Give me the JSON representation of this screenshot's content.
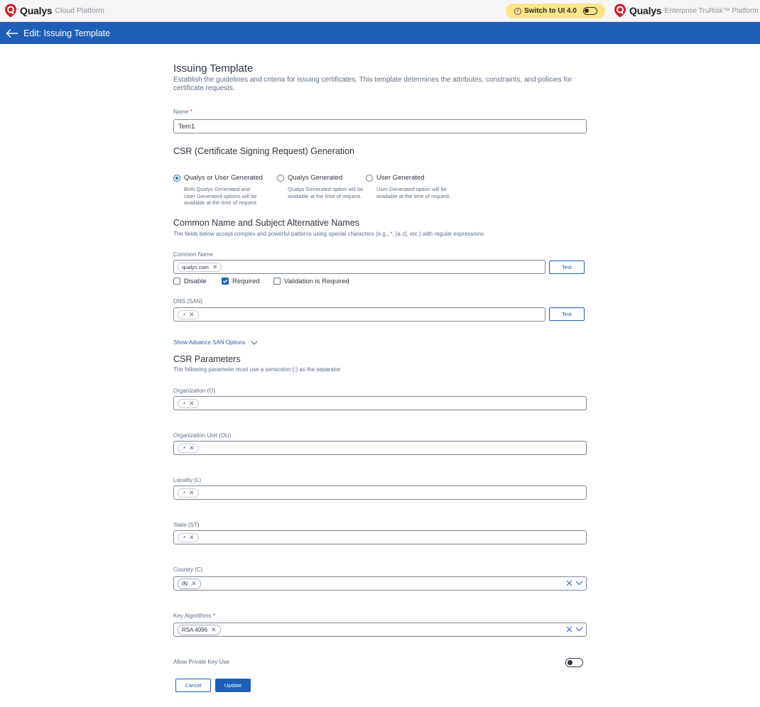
{
  "topbar": {
    "brand_name": "Qualys",
    "brand_sub": "Cloud Platform",
    "switch_label": "Switch to UI 4.0",
    "right_brand_name": "Qualys",
    "right_brand_sub": "Enterprise TruRisk™ Platform",
    "brand_color": "#d0202e"
  },
  "header": {
    "title": "Edit: Issuing Template",
    "color": "#1d5fb6"
  },
  "form": {
    "title": "Issuing Template",
    "description": "Establish the guidelines and criteria for issuing certificates. This template determines the attributes, constraints, and policies for certificate requests.",
    "name": {
      "label": "Name",
      "required_mark": "*",
      "value": "Tem1"
    },
    "csr_generation": {
      "title": "CSR (Certificate Signing Request) Generation",
      "options": [
        {
          "label": "Qualys or User Generated",
          "description": "Both Qualys Generated and User Generated options will be available at the time of request",
          "selected": true
        },
        {
          "label": "Qualys Generated",
          "description": "Qualys Generated option will be available at the time of request.",
          "selected": false
        },
        {
          "label": "User Generated",
          "description": "User Generated option will be available at the time of request.",
          "selected": false
        }
      ]
    },
    "cn_san": {
      "title": "Common Name and Subject Alternative Names",
      "description": "The fields below accept complex and powerful patterns using special characters (e.g., *, [a-z], etc.) with regular expressions",
      "common_name": {
        "label": "Common Name",
        "chip": "qualys.com",
        "test_label": "Test"
      },
      "checks": [
        {
          "label": "Disable",
          "checked": false
        },
        {
          "label": "Required",
          "checked": true
        },
        {
          "label": "Validation is Required",
          "checked": false
        }
      ],
      "dns": {
        "label": "DNS (SAN)",
        "chip": ".*",
        "test_label": "Test"
      },
      "advance_link": "Show Advance SAN Options"
    },
    "csr_params": {
      "title": "CSR Parameters",
      "description": "The following parameter must use a semicolon (;) as the separator",
      "organization": {
        "label": "Organization (O)",
        "chip": ".*"
      },
      "org_unit": {
        "label": "Organization Unit (OU)",
        "chip": ".*"
      },
      "locality": {
        "label": "Locality (L)",
        "chip": ".*"
      },
      "state": {
        "label": "State (ST)",
        "chip": ".*"
      },
      "country": {
        "label": "Country (C)",
        "chip": "IN"
      },
      "key_algorithms": {
        "label": "Key Algorithms",
        "required_mark": "*",
        "chip": "RSA 4096"
      }
    },
    "private_key": {
      "label": "Allow Private Key Use",
      "enabled": false
    },
    "buttons": {
      "cancel": "Cancel",
      "update": "Update"
    }
  }
}
